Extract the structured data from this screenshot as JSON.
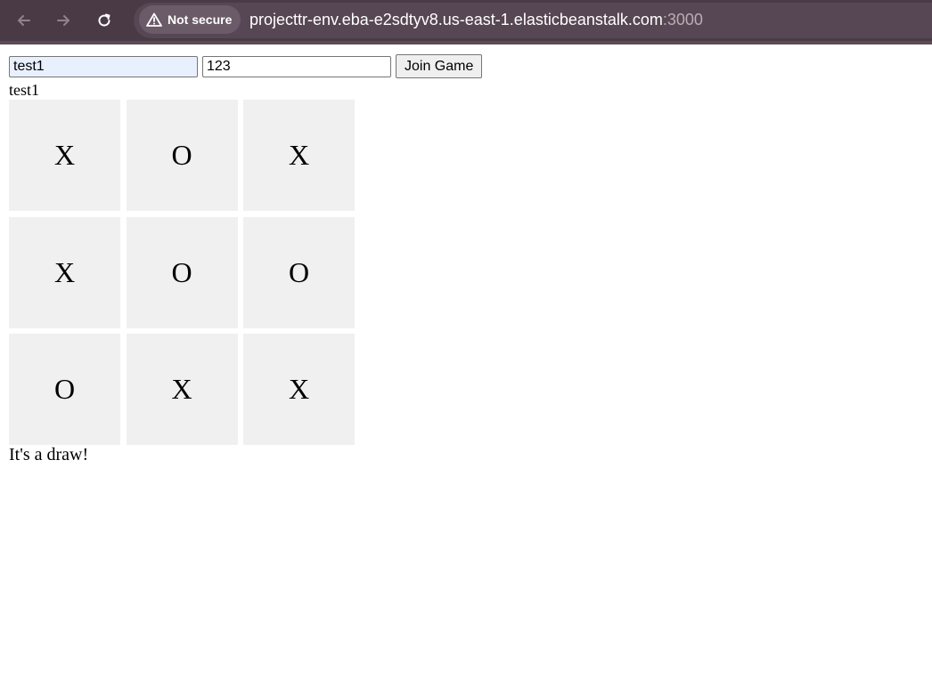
{
  "browser": {
    "security_label": "Not secure",
    "url_host": "projecttr-env.eba-e2sdtyv8.us-east-1.elasticbeanstalk.com",
    "url_port": ":3000"
  },
  "form": {
    "username_value": "test1",
    "room_value": "123",
    "join_label": "Join Game"
  },
  "player_name": "test1",
  "board": {
    "cells": [
      "X",
      "O",
      "X",
      "X",
      "O",
      "O",
      "O",
      "X",
      "X"
    ]
  },
  "status_message": "It's a draw!"
}
